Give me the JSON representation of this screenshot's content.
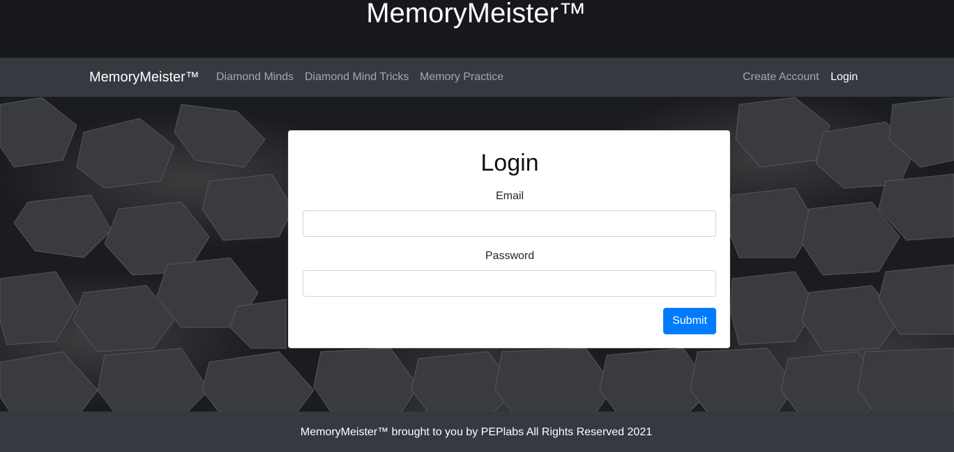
{
  "header": {
    "site_title": "MemoryMeister™"
  },
  "navbar": {
    "brand": "MemoryMeister™",
    "links": [
      {
        "label": "Diamond Minds"
      },
      {
        "label": "Diamond Mind Tricks"
      },
      {
        "label": "Memory Practice"
      }
    ],
    "right_links": [
      {
        "label": "Create Account"
      },
      {
        "label": "Login",
        "active": true
      }
    ]
  },
  "login_form": {
    "title": "Login",
    "email_label": "Email",
    "email_value": "",
    "password_label": "Password",
    "password_value": "",
    "submit_label": "Submit"
  },
  "footer": {
    "text": "MemoryMeister™ brought to you by PEPlabs All Rights Reserved 2021"
  },
  "colors": {
    "navbar_bg": "#343a40",
    "primary_button": "#007bff",
    "background": "#1b1c1f"
  }
}
